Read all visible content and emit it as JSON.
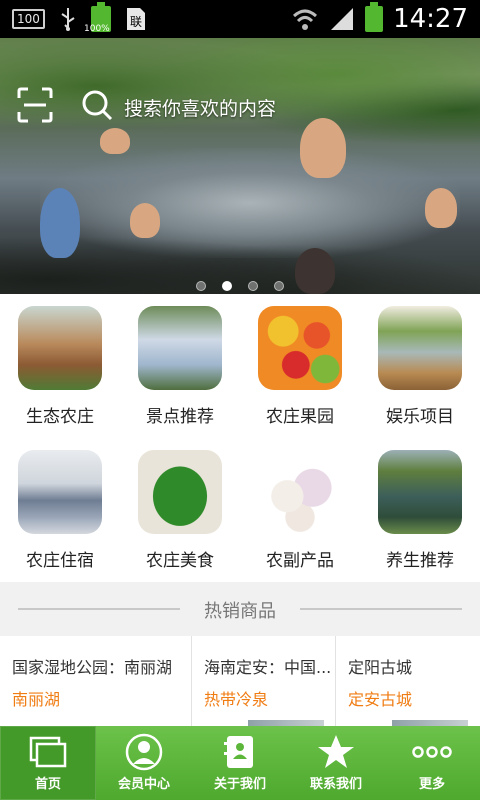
{
  "status_bar": {
    "left_badge": "100",
    "battery_pct": "100%",
    "time": "14:27"
  },
  "search": {
    "placeholder": "搜索你喜欢的内容"
  },
  "banner": {
    "page_count": 4,
    "active_index": 1
  },
  "categories": [
    {
      "label": "生态农庄",
      "thumb": "farm"
    },
    {
      "label": "景点推荐",
      "thumb": "bridge"
    },
    {
      "label": "农庄果园",
      "thumb": "fruit"
    },
    {
      "label": "娱乐项目",
      "thumb": "fishing"
    },
    {
      "label": "农庄住宿",
      "thumb": "beds"
    },
    {
      "label": "农庄美食",
      "thumb": "greens"
    },
    {
      "label": "农副产品",
      "thumb": "garlic"
    },
    {
      "label": "养生推荐",
      "thumb": "spring"
    }
  ],
  "hot": {
    "title": "热销商品",
    "items": [
      {
        "title": "国家湿地公园：南丽湖",
        "sub": "南丽湖"
      },
      {
        "title": "海南定安：中国...",
        "sub": "热带冷泉"
      },
      {
        "title": "定阳古城",
        "sub": "定安古城"
      }
    ]
  },
  "nav": [
    {
      "label": "首页",
      "icon": "home-icon"
    },
    {
      "label": "会员中心",
      "icon": "member-icon"
    },
    {
      "label": "关于我们",
      "icon": "about-icon"
    },
    {
      "label": "联系我们",
      "icon": "star-icon"
    },
    {
      "label": "更多",
      "icon": "more-icon"
    }
  ],
  "colors": {
    "accent": "#5bb63a",
    "price": "#f07d14"
  }
}
